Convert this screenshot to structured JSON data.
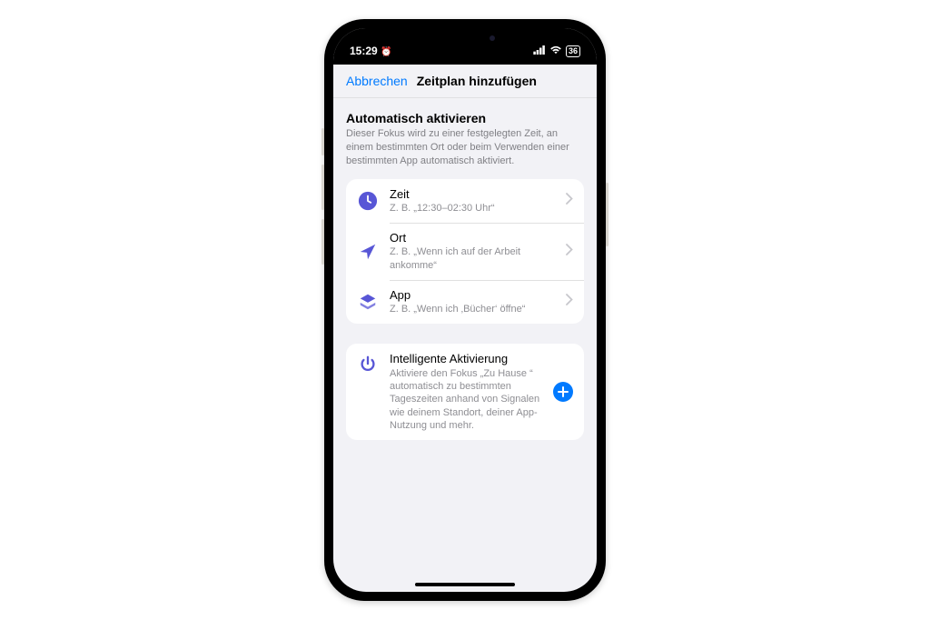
{
  "status": {
    "time": "15:29",
    "battery": "36"
  },
  "header": {
    "cancel": "Abbrechen",
    "title": "Zeitplan hinzufügen"
  },
  "section": {
    "heading": "Automatisch aktivieren",
    "sub": "Dieser Fokus wird zu einer festgelegten Zeit, an einem bestimmten Ort oder beim Verwenden einer bestimmten App automatisch aktiviert."
  },
  "rows": {
    "time": {
      "title": "Zeit",
      "sub": "Z. B. „12:30–02:30 Uhr“"
    },
    "location": {
      "title": "Ort",
      "sub": "Z. B. „Wenn ich auf der Arbeit ankomme“"
    },
    "app": {
      "title": "App",
      "sub": "Z. B. „Wenn ich ‚Bücher‘ öffne“"
    }
  },
  "smart": {
    "title": "Intelligente Aktivierung",
    "sub": "Aktiviere den Fokus „Zu Hause “ automatisch zu bestimmten Tageszeiten anhand von Signalen wie deinem Standort, deiner App-Nutzung und mehr."
  }
}
